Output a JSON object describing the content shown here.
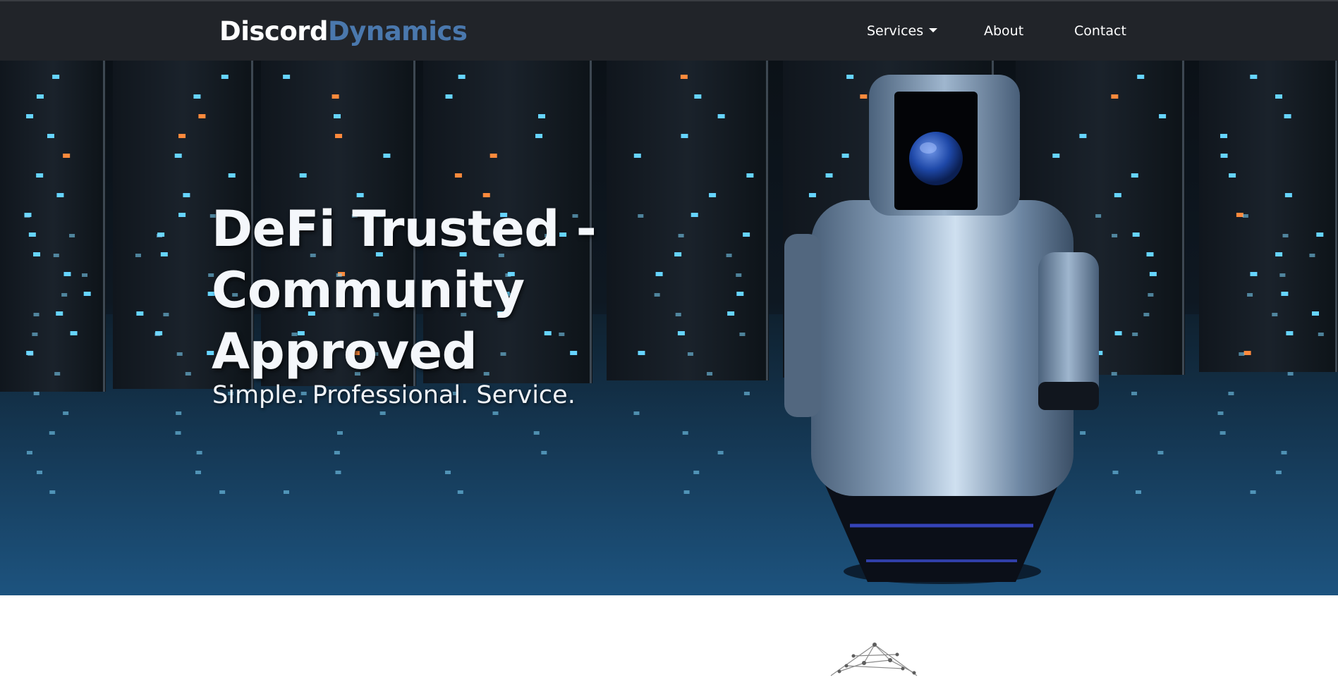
{
  "navbar": {
    "brand_primary": "Discord",
    "brand_secondary": "Dynamics",
    "links": {
      "services": "Services",
      "about": "About",
      "contact": "Contact"
    }
  },
  "hero": {
    "title": "DeFi Trusted - Community Approved",
    "subtitle": "Simple. Professional. Service."
  },
  "colors": {
    "navbar_bg": "#212429",
    "brand_accent": "#4a78ad",
    "hero_dark": "#0b1117",
    "hero_blue": "#1b4f78"
  }
}
